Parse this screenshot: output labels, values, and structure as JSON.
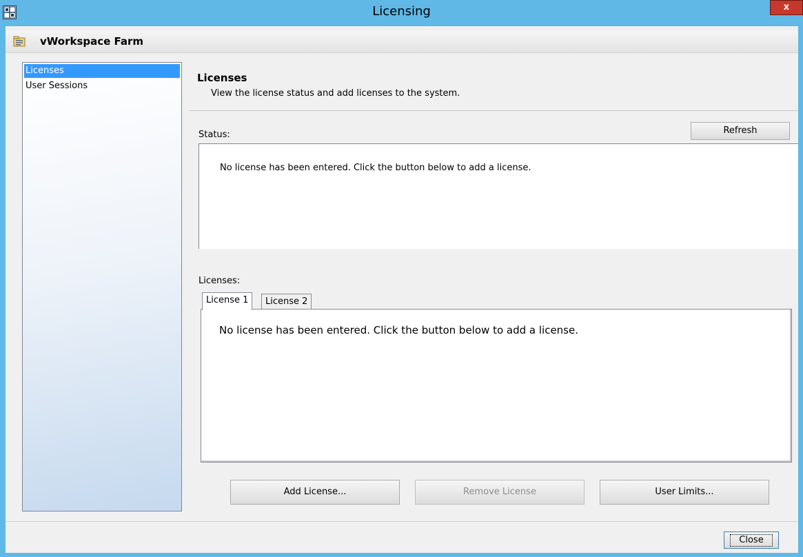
{
  "window": {
    "title": "Licensing",
    "close_glyph": "x",
    "app_icon": "grid-icon"
  },
  "header": {
    "title": "vWorkspace Farm",
    "icon": "folder-icon"
  },
  "nav": {
    "items": [
      {
        "label": "Licenses",
        "selected": true
      },
      {
        "label": "User Sessions",
        "selected": false
      }
    ]
  },
  "content": {
    "title": "Licenses",
    "description": "View the license status and add licenses to the system.",
    "status_label": "Status:",
    "refresh_label": "Refresh",
    "status_message": "No license has been entered. Click the button below to add a license.",
    "licenses_label": "Licenses:",
    "tabs": [
      {
        "label": "License 1",
        "selected": true
      },
      {
        "label": "License 2",
        "selected": false
      }
    ],
    "license_message": "No license has been entered.  Click the button below to add a license."
  },
  "actions": {
    "add_label": "Add License...",
    "remove_label": "Remove License",
    "remove_enabled": false,
    "limits_label": "User Limits..."
  },
  "footer": {
    "close_label": "Close"
  },
  "colors": {
    "frame": "#5fb8e6",
    "selection": "#3399ff",
    "close_button": "#c7382c"
  }
}
